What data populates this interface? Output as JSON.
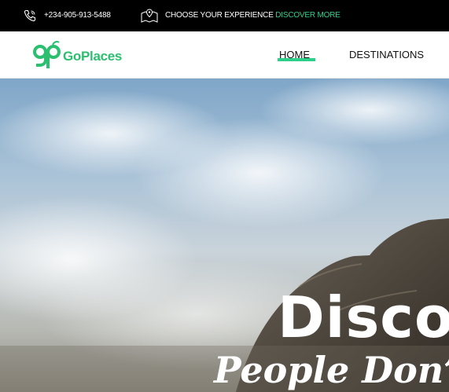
{
  "topbar": {
    "phone": "+234-905-913-5488",
    "choose_text": "CHOOSE YOUR EXPERIENCE",
    "discover_link": "DISCOVER MORE"
  },
  "brand": {
    "name": "GoPlaces",
    "accent": "#2ecf8a"
  },
  "nav": {
    "items": [
      {
        "label": "HOME",
        "active": true
      },
      {
        "label": "DESTINATIONS",
        "active": false
      }
    ]
  },
  "hero": {
    "title": "Disco",
    "subtitle": "People Don’t Ta"
  },
  "icons": [
    "phone-icon",
    "map-icon",
    "logo-icon"
  ]
}
